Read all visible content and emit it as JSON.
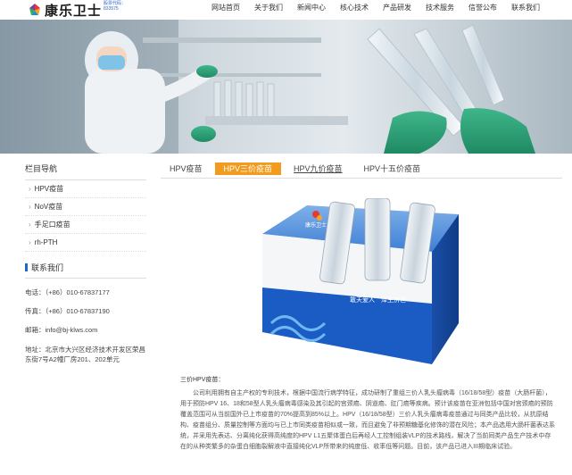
{
  "header": {
    "logo_text": "康乐卫士",
    "logo_sub": "股票代码：833575",
    "nav": [
      "网站首页",
      "关于我们",
      "新闻中心",
      "核心技术",
      "产品研发",
      "技术服务",
      "信誉公布",
      "联系我们"
    ]
  },
  "sidebar": {
    "title": "栏目导航",
    "items": [
      "HPV疫苗",
      "NoV疫苗",
      "手足口疫苗",
      "rh-PTH"
    ],
    "contact_title": "联系我们",
    "phone": "电话：（+86）010-67837177",
    "fax": "传真：（+86）010-67837190",
    "email": "邮箱：info@bj-klws.com",
    "address": "地址：北京市大兴区经济技术开发区荣昌东街7号A2幢厂房201、202单元"
  },
  "tabs": [
    "HPV疫苗",
    "HPV三价疫苗",
    "HPV九价疫苗",
    "HPV十五价疫苗"
  ],
  "active_tab": "HPV三价疫苗",
  "product_box": {
    "brand": "康乐卫士",
    "slogan": "敢天爱人　泽生济世"
  },
  "intro": {
    "heading": "三价HPV疫苗：",
    "body": "公司利用拥有自主产权的专利技术，根据中国流行病学特征，成功研制了重组三价人乳头瘤病毒（16/18/58型）疫苗（大肠杆菌），用于预防HPV 16、18和58型人乳头瘤病毒感染及其引起的宫颈癌、阴道癌、肛门癌等疾病。预计该疫苗在亚洲包括中国对宫颈癌的预防覆盖范围可从当前国外已上市疫苗的70%提高到85%以上。HPV（16/18/58型）三价人乳头瘤病毒疫苗通过与同类产品比较，从抗原结构、疫苗组分、质量控制等方面均与已上市同类疫苗相似或一致，而且避免了非预期糖基化修饰的潜在风险；本产品选用大肠杆菌表达系统，并采用先表达、分离纯化获得高纯度的HPV L1五聚体蛋白后再经人工控制组装VLP的技术路线，解决了当前同类产品生产技术中存在的从种类繁多的杂蛋白细胞裂解液中直接纯化VLP所带来的纯度低、收率低等问题。目前，该产品已进入III期临床试验。"
  }
}
